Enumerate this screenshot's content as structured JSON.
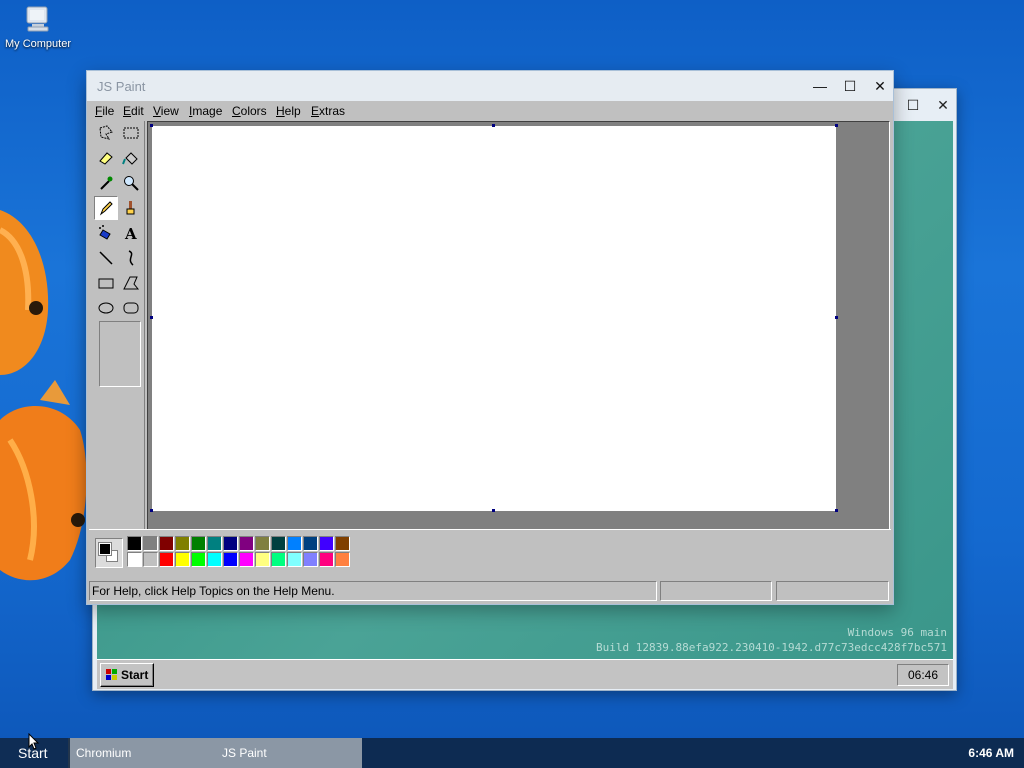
{
  "desktop": {
    "icons": [
      {
        "label": "My Computer",
        "icon": "computer-icon"
      }
    ]
  },
  "vm": {
    "controls": {
      "maximize": "☐",
      "close": "✕"
    },
    "watermark": {
      "line1": "Windows 96 main",
      "line2": "Build 12839.88efa922.230410-1942.d77c73edcc428f7bc571"
    },
    "taskbar": {
      "start_label": "Start",
      "clock": "06:46"
    }
  },
  "paint": {
    "title": "JS Paint",
    "controls": {
      "minimize": "—",
      "maximize": "☐",
      "close": "✕"
    },
    "menu": [
      {
        "first": "F",
        "rest": "ile"
      },
      {
        "first": "E",
        "rest": "dit"
      },
      {
        "first": "V",
        "rest": "iew"
      },
      {
        "first": "I",
        "rest": "mage"
      },
      {
        "first": "C",
        "rest": "olors"
      },
      {
        "first": "H",
        "rest": "elp"
      },
      {
        "first": "E",
        "rest": "xtras"
      }
    ],
    "tools": [
      "free-form-select",
      "rectangle-select",
      "eraser",
      "fill",
      "pick-color",
      "magnifier",
      "pencil",
      "brush",
      "airbrush",
      "text",
      "line",
      "curve",
      "rectangle",
      "polygon",
      "ellipse",
      "rounded-rectangle"
    ],
    "selected_tool": "pencil",
    "colors": {
      "foreground": "#000000",
      "background": "#ffffff",
      "palette_top": [
        "#000000",
        "#808080",
        "#800000",
        "#808000",
        "#008000",
        "#008080",
        "#000080",
        "#800080",
        "#808040",
        "#004040",
        "#0080ff",
        "#004080",
        "#4000ff",
        "#804000"
      ],
      "palette_bottom": [
        "#ffffff",
        "#c0c0c0",
        "#ff0000",
        "#ffff00",
        "#00ff00",
        "#00ffff",
        "#0000ff",
        "#ff00ff",
        "#ffff80",
        "#00ff80",
        "#80ffff",
        "#8080ff",
        "#ff0080",
        "#ff8040"
      ]
    },
    "status": {
      "help_text": "For Help, click Help Topics on the Help Menu.",
      "position": "",
      "size": ""
    }
  },
  "host_taskbar": {
    "start_label": "Start",
    "tasks": [
      "Chromium",
      "JS Paint"
    ],
    "clock": "6:46 AM"
  }
}
